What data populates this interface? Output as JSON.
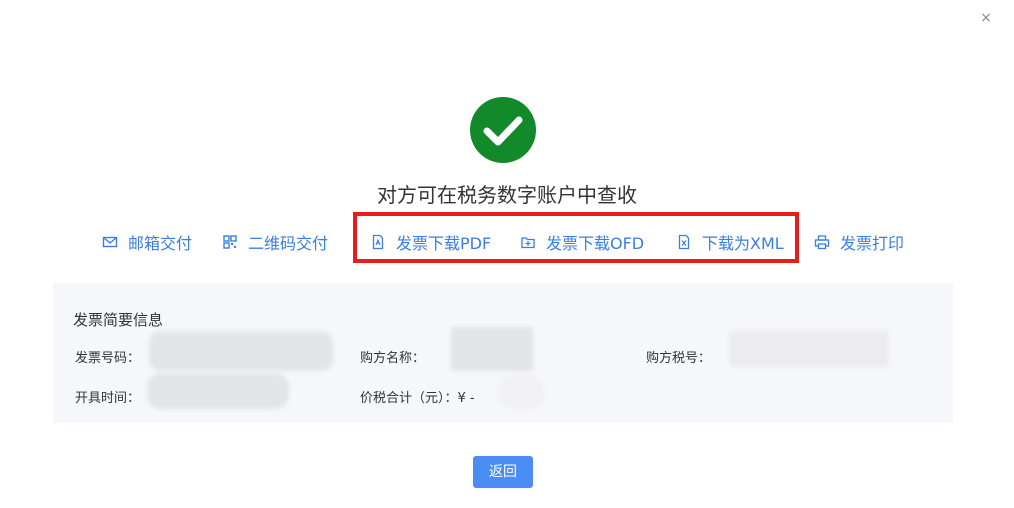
{
  "dialog": {
    "close_label": "×",
    "headline": "对方可在税务数字账户中查收"
  },
  "actions": {
    "email": {
      "label": "邮箱交付",
      "icon": "mail-icon"
    },
    "qrcode": {
      "label": "二维码交付",
      "icon": "qrcode-icon"
    },
    "pdf": {
      "label": "发票下载PDF",
      "icon": "pdf-file-icon"
    },
    "ofd": {
      "label": "发票下载OFD",
      "icon": "ofd-file-icon"
    },
    "xml": {
      "label": "下载为XML",
      "icon": "xml-file-icon"
    },
    "print": {
      "label": "发票打印",
      "icon": "printer-icon"
    }
  },
  "info": {
    "title": "发票简要信息",
    "invoice_no_label": "发票号码：",
    "buyer_name_label": "购方名称：",
    "buyer_tax_label": "购方税号：",
    "issue_time_label": "开具时间：",
    "total_label": "价税合计（元）：",
    "total_prefix": "¥ -"
  },
  "footer": {
    "return_label": "返回"
  },
  "colors": {
    "accent": "#3a7ee0",
    "success": "#128a2a",
    "highlight": "#e81c1c",
    "button": "#4a8ef3"
  }
}
